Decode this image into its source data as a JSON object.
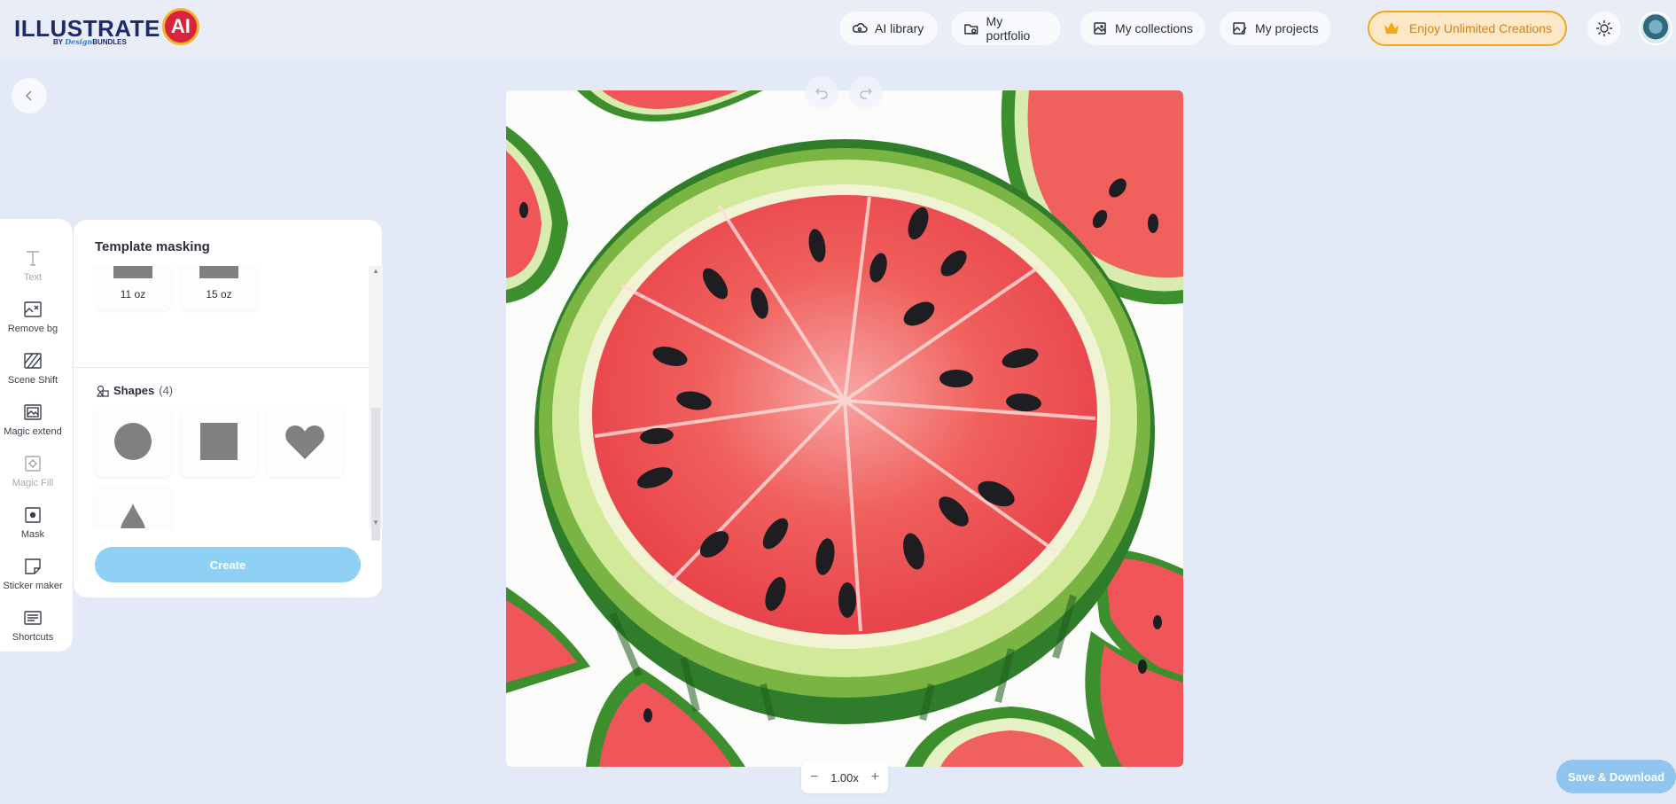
{
  "header": {
    "logo_text": "ILLUSTRATE",
    "logo_badge": "AI",
    "logo_sub_prefix": "BY",
    "logo_sub_script": "Design",
    "logo_sub_suffix": "BUNDLES",
    "nav": [
      {
        "label": "AI library",
        "icon": "brain-cloud-icon"
      },
      {
        "label": "My portfolio",
        "icon": "portfolio-icon"
      },
      {
        "label": "My collections",
        "icon": "collections-icon"
      },
      {
        "label": "My projects",
        "icon": "projects-icon"
      }
    ],
    "premium_label": "Enjoy Unlimited Creations",
    "premium_color": "#f2a71b"
  },
  "toolbar": {
    "items": [
      {
        "label": "Text",
        "icon": "text-icon",
        "disabled": true
      },
      {
        "label": "Remove bg",
        "icon": "remove-bg-icon",
        "disabled": false
      },
      {
        "label": "Scene Shift",
        "icon": "scene-shift-icon",
        "disabled": false
      },
      {
        "label": "Magic extend",
        "icon": "magic-extend-icon",
        "disabled": false
      },
      {
        "label": "Magic Fill",
        "icon": "magic-fill-icon",
        "disabled": true
      },
      {
        "label": "Mask",
        "icon": "mask-icon",
        "disabled": false
      },
      {
        "label": "Sticker maker",
        "icon": "sticker-icon",
        "disabled": false
      },
      {
        "label": "Shortcuts",
        "icon": "shortcuts-icon",
        "disabled": false
      }
    ]
  },
  "panel": {
    "title": "Template masking",
    "sizes": [
      "11 oz",
      "15 oz"
    ],
    "shapes_label": "Shapes",
    "shapes_count": "(4)",
    "shapes": [
      "circle",
      "square",
      "heart",
      "drop"
    ],
    "create_label": "Create"
  },
  "canvas": {
    "image_subject": "watercolor watermelon"
  },
  "zoom": {
    "minus": "−",
    "level": "1.00x",
    "plus": "+"
  },
  "save_label": "Save & Download",
  "colors": {
    "accent": "#8fd0f5",
    "background": "#e3e9f7"
  }
}
